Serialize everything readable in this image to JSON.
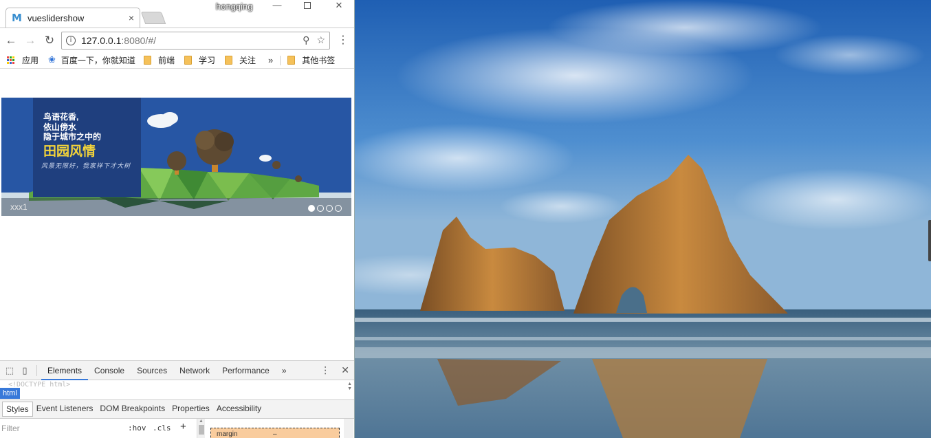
{
  "window": {
    "user": "hongqing",
    "min_glyph": "—",
    "close_glyph": "✕"
  },
  "tab": {
    "favicon": "M",
    "title": "vueslidershow",
    "close": "×"
  },
  "toolbar": {
    "back": "←",
    "forward": "→",
    "reload": "↻",
    "info": "i",
    "url_host": "127.0.0.1",
    "url_rest": ":8080/#/",
    "zoom_icon": "⚲",
    "star_icon": "☆",
    "menu": "⋮"
  },
  "bookmarks": {
    "apps": "应用",
    "baidu": "百度一下，你就知道",
    "folder1": "前端",
    "folder2": "学习",
    "folder3": "关注",
    "more": "»",
    "other": "其他书签"
  },
  "slider": {
    "line1": "鸟语花香,",
    "line2": "依山傍水",
    "line3": "隐于城市之中的",
    "title": "田园风情",
    "subtitle": "风景无限好，我家祥下才大树",
    "caption": "xxx1",
    "slide_count": 4,
    "active_index": 0,
    "colors": {
      "bg": "#2756a4",
      "title": "#f2d33a"
    }
  },
  "devtools": {
    "inspect_icon": "⬚",
    "device_icon": "▯",
    "tabs": [
      "Elements",
      "Console",
      "Sources",
      "Network",
      "Performance"
    ],
    "more": "»",
    "menu": "⋮",
    "close": "✕",
    "doctype": "<!DOCTYPE html>",
    "crumb": "html",
    "subtabs": [
      "Styles",
      "Event Listeners",
      "DOM Breakpoints",
      "Properties",
      "Accessibility"
    ],
    "filter_placeholder": "Filter",
    "hov": ":hov",
    "cls": ".cls",
    "plus": "+",
    "box_label": "margin",
    "box_value": "–"
  }
}
